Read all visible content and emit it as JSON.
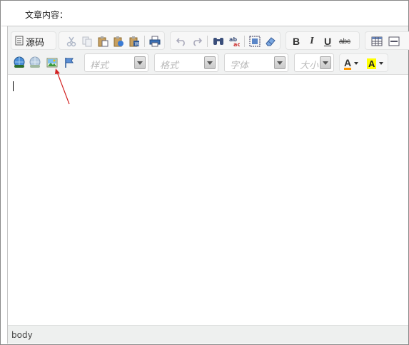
{
  "form": {
    "content_label": "文章内容："
  },
  "toolbar": {
    "row1": {
      "source_label": "源码",
      "buttons": [
        "cut-icon",
        "copy-icon",
        "paste-icon",
        "paste-text-icon",
        "paste-word-icon",
        "print-icon",
        "undo-icon",
        "redo-icon",
        "find-icon",
        "replace-icon",
        "select-all-icon",
        "remove-format-icon",
        "bold-icon",
        "italic-icon",
        "underline-icon",
        "strikethrough-icon",
        "table-icon",
        "horizontal-rule-icon"
      ],
      "bold_glyph": "B",
      "italic_glyph": "I",
      "underline_glyph": "U",
      "strike_glyph": "abc"
    },
    "row2": {
      "buttons": [
        "link-icon",
        "unlink-icon",
        "image-icon",
        "anchor-flag-icon"
      ],
      "styles_placeholder": "样式",
      "format_placeholder": "格式",
      "font_placeholder": "字体",
      "size_placeholder": "大小",
      "text_color_glyph": "A",
      "bg_color_glyph": "A"
    }
  },
  "editor": {
    "content": ""
  },
  "statusbar": {
    "path": "body"
  },
  "colors": {
    "annotation_arrow": "#d22222",
    "icon_blue": "#2a5a9a",
    "text_color_accent": "#ff9900",
    "bg_color_accent": "#ffff00"
  }
}
